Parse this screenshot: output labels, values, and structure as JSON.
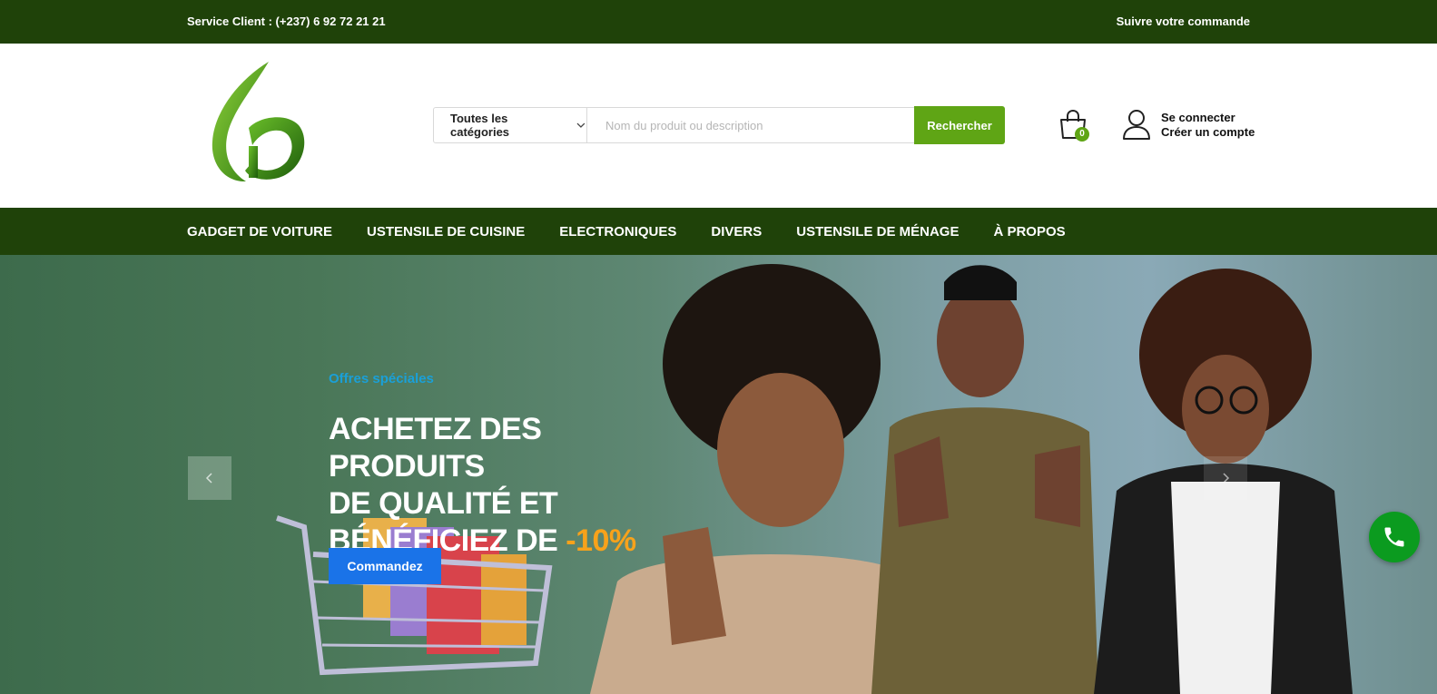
{
  "topbar": {
    "service": "Service Client : (+237) 6 92 72 21 21",
    "track_order": "Suivre votre commande"
  },
  "search": {
    "category_label": "Toutes les catégories",
    "placeholder": "Nom du produit ou description",
    "value": "",
    "button": "Rechercher"
  },
  "cart": {
    "count": "0",
    "icon": "shopping-bag-icon"
  },
  "account": {
    "login": "Se connecter",
    "register": "Créer un compte",
    "icon": "user-icon"
  },
  "nav": {
    "items": [
      {
        "label": "GADGET DE VOITURE"
      },
      {
        "label": "USTENSILE DE CUISINE"
      },
      {
        "label": "ELECTRONIQUES"
      },
      {
        "label": "DIVERS"
      },
      {
        "label": "USTENSILE DE MÉNAGE"
      },
      {
        "label": "À PROPOS"
      }
    ]
  },
  "hero": {
    "eyebrow": "Offres spéciales",
    "title_line1": "ACHETEZ DES PRODUITS",
    "title_line2": "DE QUALITÉ ET",
    "title_line3": "BÉNÉFICIEZ DE ",
    "title_accent": "-10%",
    "cta": "Commandez"
  },
  "colors": {
    "dark_green": "#1f4209",
    "brand_green": "#5fa515",
    "accent_orange": "#f7a21b",
    "cta_blue": "#1a73e8",
    "eyebrow_blue": "#1aa0d8",
    "call_green": "#0b9b1f"
  }
}
